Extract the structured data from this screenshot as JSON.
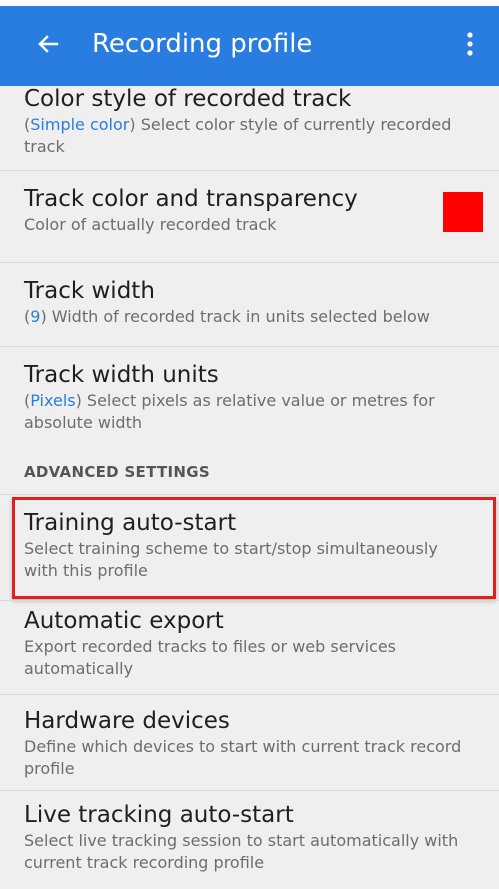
{
  "appbar": {
    "title": "Recording profile",
    "back_icon": "arrow-back-icon",
    "menu_icon": "more-vert-icon",
    "color": "#2a7de0"
  },
  "items": [
    {
      "title": "Color style of recorded track",
      "value": "Simple color",
      "summary_rest": "Select color style of currently recorded track"
    },
    {
      "title": "Track color and transparency",
      "summary": "Color of actually recorded track",
      "swatch_color": "#ff0000"
    },
    {
      "title": "Track width",
      "value": "9",
      "summary_rest": "Width of recorded track in units selected below"
    },
    {
      "title": "Track width units",
      "value": "Pixels",
      "summary_rest": "Select pixels as relative value or metres for absolute width"
    }
  ],
  "section_header": "ADVANCED SETTINGS",
  "advanced_items": [
    {
      "title": "Training auto-start",
      "summary": "Select training scheme to start/stop simultaneously with this profile",
      "highlighted": true
    },
    {
      "title": "Automatic export",
      "summary": "Export recorded tracks to files or web services automatically"
    },
    {
      "title": "Hardware devices",
      "summary": "Define which devices to start with current track record profile"
    },
    {
      "title": "Live tracking auto-start",
      "summary": "Select live tracking session to start automatically with current track recording profile"
    }
  ],
  "highlight_color": "#e0201c"
}
